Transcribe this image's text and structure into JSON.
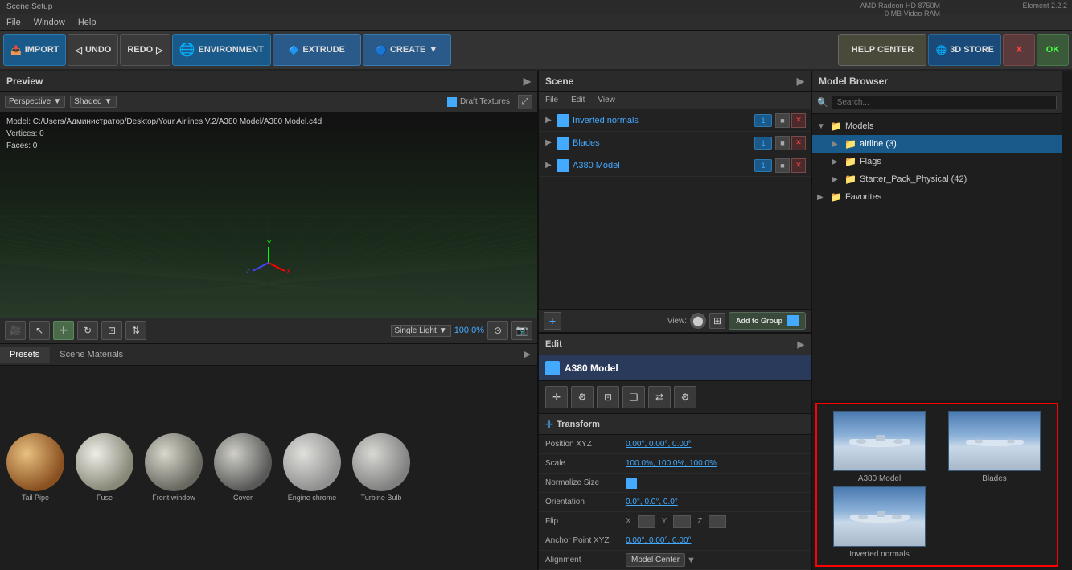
{
  "titleBar": {
    "title": "Scene Setup"
  },
  "menuBar": {
    "items": [
      "File",
      "Window",
      "Help"
    ]
  },
  "gpuInfo": {
    "gpu": "AMD Radeon HD 8750M",
    "vram": "0 MB Video RAM",
    "element": "Element  2.2.2"
  },
  "toolbar": {
    "import": "IMPORT",
    "undo": "UNDO",
    "redo": "REDO",
    "environment": "ENVIRONMENT",
    "extrude": "EXTRUDE",
    "create": "CREATE",
    "helpCenter": "HELP CENTER",
    "store": "3D STORE",
    "x": "X",
    "ok": "OK"
  },
  "preview": {
    "title": "Preview",
    "draftTextures": "Draft Textures",
    "perspective": "Perspective",
    "shaded": "Shaded",
    "modelInfo": {
      "model": "Model: C:/Users/Администратор/Desktop/Your Airlines V.2/A380 Model/A380 Model.c4d",
      "vertices": "Vertices:  0",
      "faces": "Faces:  0"
    },
    "zoom": "100.0%",
    "lightMode": "Single Light"
  },
  "bottomTabs": {
    "presets": "Presets",
    "sceneMaterials": "Scene Materials"
  },
  "materials": [
    {
      "label": "Tail Pipe",
      "color1": "#c8a060",
      "color2": "#8a6030"
    },
    {
      "label": "Fuse",
      "color1": "#d4d0c8",
      "color2": "#888880"
    },
    {
      "label": "Front window",
      "color1": "#c0c0b8",
      "color2": "#787870"
    },
    {
      "label": "Cover",
      "color1": "#b0b0a8",
      "color2": "#606060"
    },
    {
      "label": "Engine chrome",
      "color1": "#c8c8c4",
      "color2": "#909090"
    },
    {
      "label": "Turbine Bulb",
      "color1": "#c0c0bc",
      "color2": "#888888"
    }
  ],
  "scene": {
    "title": "Scene",
    "menuItems": [
      "File",
      "Edit",
      "View"
    ],
    "items": [
      {
        "name": "Inverted normals",
        "badge": "1",
        "expanded": false
      },
      {
        "name": "Blades",
        "badge": "1",
        "expanded": false
      },
      {
        "name": "A380 Model",
        "badge": "1",
        "expanded": false
      }
    ],
    "viewLabel": "View:",
    "addToGroup": "Add to Group"
  },
  "edit": {
    "title": "Edit",
    "objectName": "A380 Model",
    "transform": "Transform",
    "properties": [
      {
        "label": "Position XYZ",
        "value": "0.00°,  0.00°,  0.00°",
        "type": "link"
      },
      {
        "label": "Scale",
        "value": "100.0%,  100.0%,  100.0%",
        "type": "link"
      },
      {
        "label": "Normalize Size",
        "value": "",
        "type": "checkbox"
      },
      {
        "label": "Orientation",
        "value": "0.0°,  0.0°,  0.0°",
        "type": "link"
      },
      {
        "label": "Flip",
        "value": "X  Y  Z",
        "type": "flip"
      },
      {
        "label": "Anchor Point XYZ",
        "value": "0.00°,  0.00°,  0.00°",
        "type": "link"
      },
      {
        "label": "Alignment",
        "value": "Model Center",
        "type": "select"
      }
    ]
  },
  "modelBrowser": {
    "title": "Model Browser",
    "searchPlaceholder": "Search...",
    "tree": [
      {
        "label": "Models",
        "expanded": true,
        "level": 0,
        "icon": "folder"
      },
      {
        "label": "airline (3)",
        "expanded": false,
        "level": 1,
        "icon": "folder",
        "selected": true
      },
      {
        "label": "Flags",
        "expanded": false,
        "level": 1,
        "icon": "folder"
      },
      {
        "label": "Starter_Pack_Physical (42)",
        "expanded": false,
        "level": 1,
        "icon": "folder"
      },
      {
        "label": "Favorites",
        "expanded": false,
        "level": 0,
        "icon": "folder"
      }
    ],
    "thumbnails": [
      {
        "label": "A380 Model",
        "sky": true
      },
      {
        "label": "Blades",
        "sky": true
      },
      {
        "label": "Inverted normals",
        "sky": true
      }
    ]
  }
}
